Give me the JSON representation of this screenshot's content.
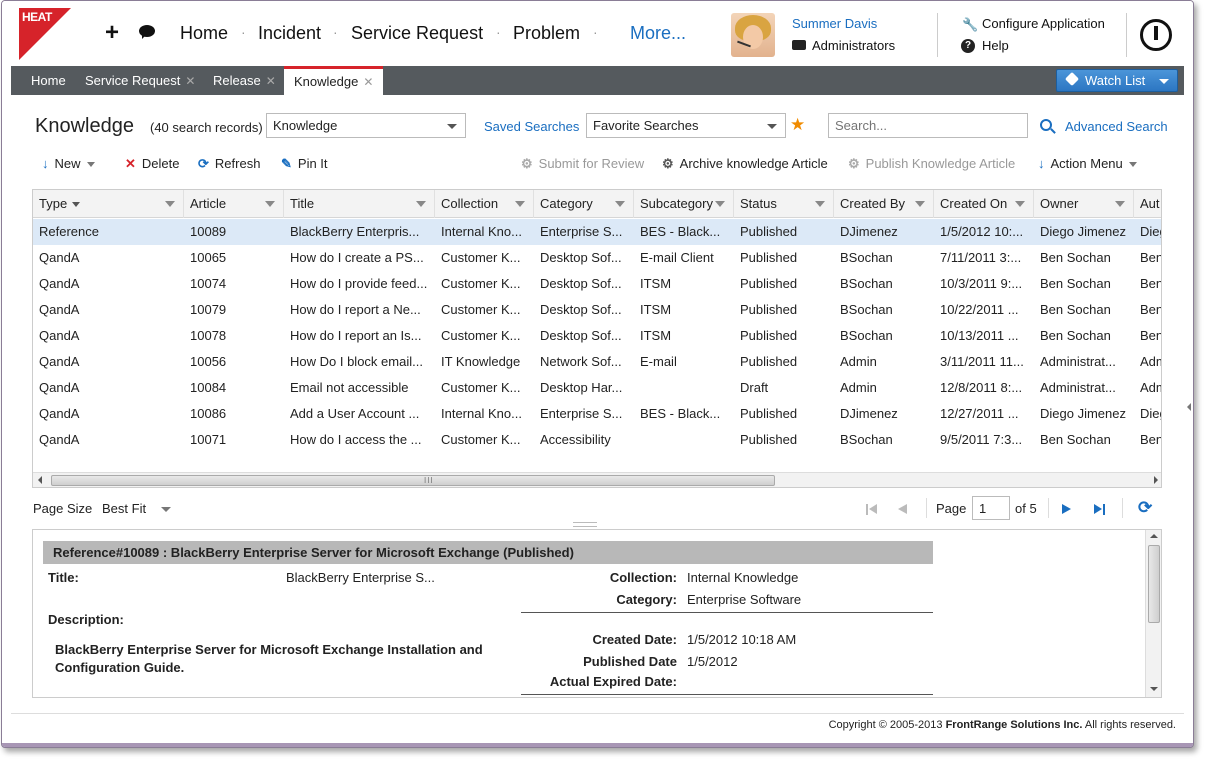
{
  "logo": {
    "text": "HEAT"
  },
  "topnav": {
    "items": [
      "Home",
      "Incident",
      "Service Request",
      "Problem"
    ],
    "more": "More...",
    "separator": "·"
  },
  "user": {
    "name": "Summer Davis",
    "role": "Administrators"
  },
  "header_links": {
    "configure": "Configure Application",
    "help": "Help",
    "help_glyph": "?"
  },
  "tabs": [
    {
      "label": "Home",
      "closable": false
    },
    {
      "label": "Service Request",
      "closable": true
    },
    {
      "label": "Release",
      "closable": true
    },
    {
      "label": "Knowledge",
      "closable": true,
      "active": true
    }
  ],
  "tab_close_glyph": "✕",
  "watch_list": {
    "label": "Watch List"
  },
  "workspace": {
    "title": "Knowledge",
    "record_count": "(40 search records)",
    "object_select": "Knowledge",
    "saved_searches": "Saved Searches",
    "favorite_select": "Favorite Searches",
    "search_placeholder": "Search...",
    "advanced_search": "Advanced Search"
  },
  "toolbar": {
    "new": "New",
    "delete": "Delete",
    "refresh": "Refresh",
    "pin": "Pin It",
    "submit_review": "Submit for Review",
    "archive": "Archive knowledge Article",
    "publish": "Publish Knowledge Article",
    "action_menu": "Action Menu"
  },
  "grid": {
    "columns": [
      "Type",
      "Article",
      "Title",
      "Collection",
      "Category",
      "Subcategory",
      "Status",
      "Created By",
      "Created On",
      "Owner",
      "Aut"
    ],
    "rows": [
      [
        "Reference",
        "10089",
        "BlackBerry Enterpris...",
        "Internal Kno...",
        "Enterprise S...",
        "BES - Black...",
        "Published",
        "DJimenez",
        "1/5/2012 10:...",
        "Diego Jimenez",
        "Dieg"
      ],
      [
        "QandA",
        "10065",
        "How do I create a PS...",
        "Customer K...",
        "Desktop Sof...",
        "E-mail Client",
        "Published",
        "BSochan",
        "7/11/2011 3:...",
        "Ben Sochan",
        "Ben"
      ],
      [
        "QandA",
        "10074",
        "How do I provide feed...",
        "Customer K...",
        "Desktop Sof...",
        "ITSM",
        "Published",
        "BSochan",
        "10/3/2011 9:...",
        "Ben Sochan",
        "Ben"
      ],
      [
        "QandA",
        "10079",
        "How do I report a Ne...",
        "Customer K...",
        "Desktop Sof...",
        "ITSM",
        "Published",
        "BSochan",
        "10/22/2011 ...",
        "Ben Sochan",
        "Ben"
      ],
      [
        "QandA",
        "10078",
        "How do I report an Is...",
        "Customer K...",
        "Desktop Sof...",
        "ITSM",
        "Published",
        "BSochan",
        "10/13/2011 ...",
        "Ben Sochan",
        "Ben"
      ],
      [
        "QandA",
        "10056",
        "How Do I block email...",
        "IT Knowledge",
        "Network Sof...",
        "E-mail",
        "Published",
        "Admin",
        "3/11/2011 11...",
        "Administrat...",
        "Adm"
      ],
      [
        "QandA",
        "10084",
        "Email not accessible",
        "Customer K...",
        "Desktop Har...",
        "",
        "Draft",
        "Admin",
        "12/8/2011 8:...",
        "Administrat...",
        "Adm"
      ],
      [
        "QandA",
        "10086",
        "Add a User Account ...",
        "Internal Kno...",
        "Enterprise S...",
        "BES - Black...",
        "Published",
        "DJimenez",
        "12/27/2011 ...",
        "Diego Jimenez",
        "Dieg"
      ],
      [
        "QandA",
        "10071",
        "How do I access the ...",
        "Customer K...",
        "Accessibility",
        "",
        "Published",
        "BSochan",
        "9/5/2011 7:3...",
        "Ben Sochan",
        "Ben"
      ]
    ],
    "scroll_grip": "III"
  },
  "pager": {
    "page_size_label": "Page Size",
    "page_size_value": "Best Fit",
    "page_label": "Page",
    "page_value": "1",
    "of_label": "of 5"
  },
  "detail": {
    "header": "Reference#10089 :  BlackBerry Enterprise Server for Microsoft Exchange (Published)",
    "title_label": "Title:",
    "title_value": "BlackBerry Enterprise S...",
    "collection_label": "Collection:",
    "collection_value": "Internal Knowledge",
    "category_label": "Category:",
    "category_value": "Enterprise Software",
    "description_label": "Description:",
    "description_value": "BlackBerry Enterprise Server for Microsoft Exchange Installation and Configuration Guide.",
    "created_label": "Created Date:",
    "created_value": "1/5/2012 10:18 AM",
    "published_label": "Published Date",
    "published_value": "1/5/2012",
    "expired_label": "Actual Expired Date:"
  },
  "footer": {
    "copyright_pre": "Copyright © 2005-2013 ",
    "copyright_company": "FrontRange Solutions Inc.",
    "copyright_post": " All rights reserved."
  },
  "colors": {
    "accent": "#1a6ec0",
    "tab_active_border": "#d6232a",
    "tabstrip": "#555a5e",
    "selected_row": "#dce9f7"
  }
}
